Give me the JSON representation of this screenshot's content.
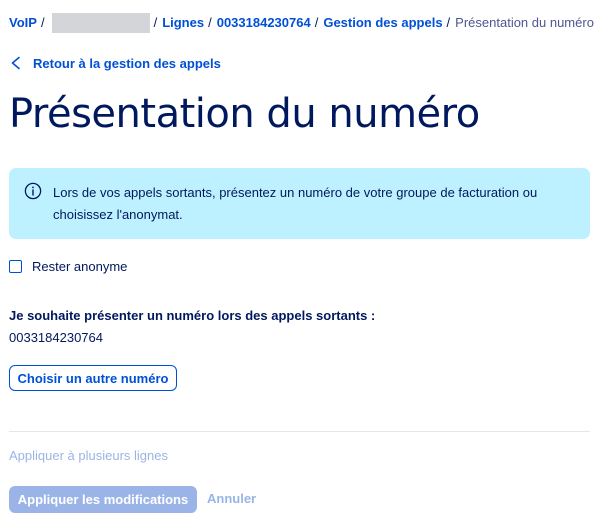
{
  "breadcrumb": {
    "root": "VoIP",
    "lines": "Lignes",
    "line_number": "0033184230764",
    "call_management": "Gestion des appels",
    "current": "Présentation du numéro"
  },
  "back_link": {
    "label": "Retour à la gestion des appels"
  },
  "page": {
    "title": "Présentation du numéro"
  },
  "info": {
    "text": "Lors de vos appels sortants, présentez un numéro de votre groupe de facturation ou choisissez l'anonymat."
  },
  "anonymous": {
    "label": "Rester anonyme",
    "checked": false
  },
  "presentation": {
    "label": "Je souhaite présenter un numéro lors des appels sortants :",
    "number": "0033184230764",
    "choose_other_label": "Choisir un autre numéro"
  },
  "footer": {
    "apply_multiple_label": "Appliquer à plusieurs lignes",
    "apply_label": "Appliquer les modifications",
    "cancel_label": "Annuler"
  },
  "colors": {
    "primary": "#0050d7",
    "text": "#00185e",
    "info_background": "#bef1ff",
    "disabled_primary": "#9bb4e8",
    "disabled_text": "#99b5e6",
    "redacted": "#d3d5d9"
  }
}
